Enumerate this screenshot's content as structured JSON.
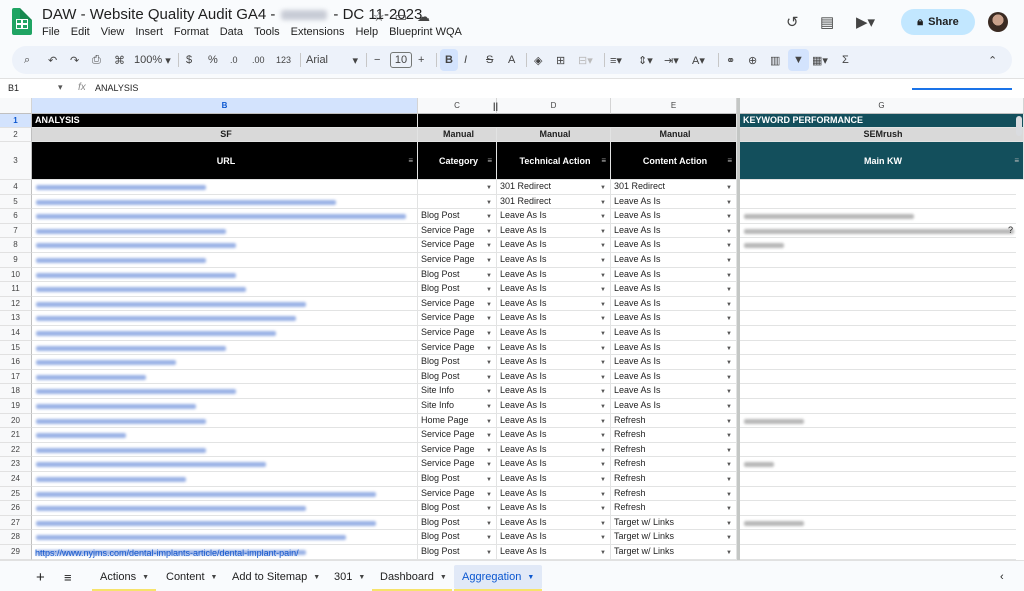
{
  "app": {
    "title_prefix": "DAW - Website Quality Audit GA4 -",
    "title_suffix": "- DC 11-2023",
    "menu": [
      "File",
      "Edit",
      "View",
      "Insert",
      "Format",
      "Data",
      "Tools",
      "Extensions",
      "Help",
      "Blueprint WQA"
    ],
    "share_label": "Share",
    "icons": [
      "star-icon",
      "folder-icon",
      "cloud-icon",
      "history-icon",
      "comment-icon",
      "video-icon",
      "lock-icon"
    ]
  },
  "toolbar": {
    "zoom": "100%",
    "currency": "$",
    "percent": "%",
    "dec_dec": ".0",
    "dec_inc": ".00",
    "number_fmt": "123",
    "font": "Arial",
    "font_size": "10",
    "bold": "B",
    "italic": "I",
    "strike": "S",
    "text_color": "A",
    "sigma": "Σ"
  },
  "formula_bar": {
    "cell_ref": "B1",
    "fx": "fx",
    "value": "ANALYSIS"
  },
  "columns": [
    "B",
    "C",
    "D",
    "E",
    "G"
  ],
  "row_numbers": [
    1,
    2,
    3,
    4,
    5,
    6,
    7,
    8,
    9,
    10,
    11,
    12,
    13,
    14,
    15,
    16,
    17,
    18,
    19,
    20,
    21,
    22,
    23,
    24,
    25,
    26,
    27,
    28,
    29
  ],
  "header": {
    "analysis": "ANALYSIS",
    "keyword_performance": "KEYWORD PERFORMANCE",
    "sf": "SF",
    "manual_c": "Manual",
    "manual_d": "Manual",
    "manual_e": "Manual",
    "semrush": "SEMrush",
    "url": "URL",
    "category": "Category",
    "technical_action": "Technical Action",
    "content_action": "Content Action",
    "main_kw": "Main KW"
  },
  "rows": [
    {
      "category": "",
      "technical": "301 Redirect",
      "content": "301 Redirect"
    },
    {
      "category": "",
      "technical": "301 Redirect",
      "content": "Leave As Is"
    },
    {
      "category": "Blog Post",
      "technical": "Leave As Is",
      "content": "Leave As Is"
    },
    {
      "category": "Service Page",
      "technical": "Leave As Is",
      "content": "Leave As Is"
    },
    {
      "category": "Service Page",
      "technical": "Leave As Is",
      "content": "Leave As Is"
    },
    {
      "category": "Service Page",
      "technical": "Leave As Is",
      "content": "Leave As Is"
    },
    {
      "category": "Blog Post",
      "technical": "Leave As Is",
      "content": "Leave As Is"
    },
    {
      "category": "Blog Post",
      "technical": "Leave As Is",
      "content": "Leave As Is"
    },
    {
      "category": "Service Page",
      "technical": "Leave As Is",
      "content": "Leave As Is"
    },
    {
      "category": "Service Page",
      "technical": "Leave As Is",
      "content": "Leave As Is"
    },
    {
      "category": "Service Page",
      "technical": "Leave As Is",
      "content": "Leave As Is"
    },
    {
      "category": "Service Page",
      "technical": "Leave As Is",
      "content": "Leave As Is"
    },
    {
      "category": "Blog Post",
      "technical": "Leave As Is",
      "content": "Leave As Is"
    },
    {
      "category": "Blog Post",
      "technical": "Leave As Is",
      "content": "Leave As Is"
    },
    {
      "category": "Site Info",
      "technical": "Leave As Is",
      "content": "Leave As Is"
    },
    {
      "category": "Site Info",
      "technical": "Leave As Is",
      "content": "Leave As Is"
    },
    {
      "category": "Home Page",
      "technical": "Leave As Is",
      "content": "Refresh"
    },
    {
      "category": "Service Page",
      "technical": "Leave As Is",
      "content": "Refresh"
    },
    {
      "category": "Service Page",
      "technical": "Leave As Is",
      "content": "Refresh"
    },
    {
      "category": "Service Page",
      "technical": "Leave As Is",
      "content": "Refresh"
    },
    {
      "category": "Blog Post",
      "technical": "Leave As Is",
      "content": "Refresh"
    },
    {
      "category": "Service Page",
      "technical": "Leave As Is",
      "content": "Refresh"
    },
    {
      "category": "Blog Post",
      "technical": "Leave As Is",
      "content": "Refresh"
    },
    {
      "category": "Blog Post",
      "technical": "Leave As Is",
      "content": "Target w/ Links"
    },
    {
      "category": "Blog Post",
      "technical": "Leave As Is",
      "content": "Target w/ Links"
    },
    {
      "category": "Blog Post",
      "technical": "Leave As Is",
      "content": "Target w/ Links"
    }
  ],
  "row29_url": "https://www.nyjms.com/dental-implants-article/dental-implant-pain/",
  "g7_suffix": "?",
  "tabs": [
    {
      "label": "Actions"
    },
    {
      "label": "Content"
    },
    {
      "label": "Add to Sitemap"
    },
    {
      "label": "301"
    },
    {
      "label": "Dashboard"
    },
    {
      "label": "Aggregation"
    }
  ],
  "colors": {
    "header_black": "#000000",
    "header_teal": "#134f5c",
    "header_grey": "#d9d9d9",
    "share": "#c2e7ff",
    "selection": "#d3e3fd",
    "tab_underline": "#f7e36b"
  }
}
